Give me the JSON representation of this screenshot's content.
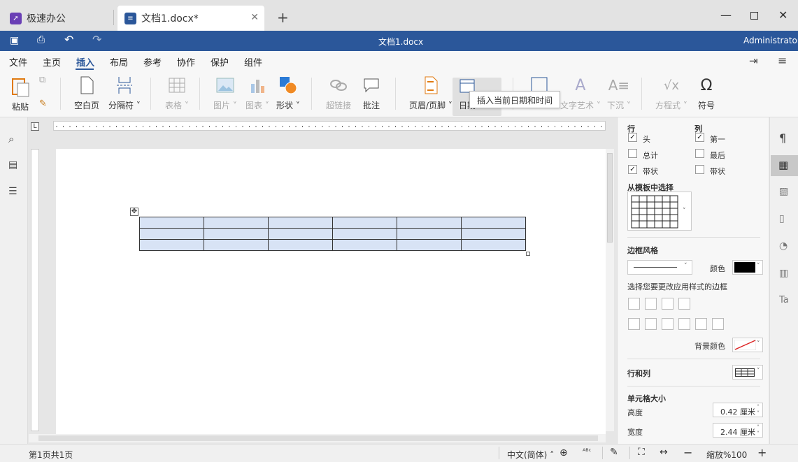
{
  "tabs": [
    {
      "label": "极速办公"
    },
    {
      "label": "文档1.docx*"
    }
  ],
  "titlebar": {
    "doc_title": "文档1.docx",
    "user": "Administrator"
  },
  "menu": [
    "文件",
    "主页",
    "插入",
    "布局",
    "参考",
    "协作",
    "保护",
    "组件"
  ],
  "ribbon": {
    "paste": "粘贴",
    "blank_page": "空白页",
    "separator": "分隔符",
    "table": "表格",
    "image": "图片",
    "chart": "图表",
    "shape": "形状",
    "hyperlink": "超链接",
    "comment": "批注",
    "header_footer": "页眉/页脚",
    "date": "日期",
    "textart": "文字艺术",
    "dropcap": "下沉",
    "formula": "方程式",
    "symbol": "符号"
  },
  "tooltip": "插入当前日期和时间",
  "panel": {
    "row_title": "行",
    "col_title": "列",
    "header": "头",
    "total": "总计",
    "banded_row": "带状",
    "first": "第一",
    "last": "最后",
    "banded_col": "带状",
    "template_label": "从模板中选择",
    "border_style": "边框风格",
    "color": "颜色",
    "apply_border": "选择您要更改应用样式的边框",
    "bg_color": "背景颜色",
    "rows_cols": "行和列",
    "cell_size": "单元格大小",
    "height_label": "高度",
    "height_value": "0.42 厘米",
    "width_label": "宽度",
    "width_value": "2.44 厘米",
    "checks": {
      "header": true,
      "total": false,
      "banded_row": true,
      "first": true,
      "last": false,
      "banded_col": false
    }
  },
  "status": {
    "page": "第1页共1页",
    "lang": "中文(简体)",
    "zoom": "缩放%100"
  },
  "table": {
    "rows": 3,
    "cols": 6
  },
  "colors": {
    "accent": "#2b579a",
    "cell_fill": "#d8e3f5"
  }
}
